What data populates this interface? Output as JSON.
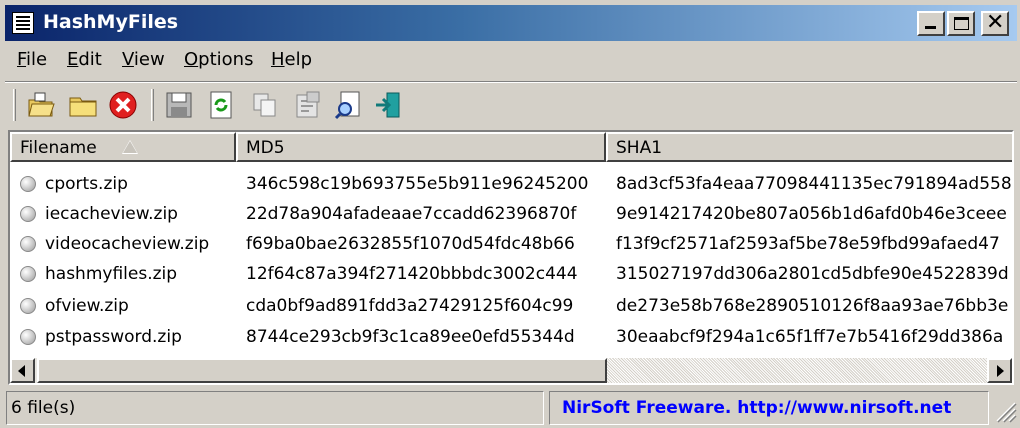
{
  "window": {
    "title": "HashMyFiles"
  },
  "menu": [
    "File",
    "Edit",
    "View",
    "Options",
    "Help"
  ],
  "toolbar": [
    {
      "name": "open-files-icon"
    },
    {
      "name": "open-folder-icon"
    },
    {
      "name": "remove-icon"
    },
    {
      "name": "save-icon"
    },
    {
      "name": "refresh-icon"
    },
    {
      "name": "copy-icon"
    },
    {
      "name": "properties-icon"
    },
    {
      "name": "find-icon"
    },
    {
      "name": "exit-icon"
    }
  ],
  "columns": [
    "Filename",
    "MD5",
    "SHA1"
  ],
  "rows": [
    {
      "filename": "cports.zip",
      "md5": "346c598c19b693755e5b911e96245200",
      "sha1": "8ad3cf53fa4eaa77098441135ec791894ad558"
    },
    {
      "filename": "iecacheview.zip",
      "md5": "22d78a904afadeaae7ccadd62396870f",
      "sha1": "9e914217420be807a056b1d6afd0b46e3ceee"
    },
    {
      "filename": "videocacheview.zip",
      "md5": "f69ba0bae2632855f1070d54fdc48b66",
      "sha1": "f13f9cf2571af2593af5be78e59fbd99afaed47"
    },
    {
      "filename": "hashmyfiles.zip",
      "md5": "12f64c87a394f271420bbbdc3002c444",
      "sha1": "315027197dd306a2801cd5dbfe90e4522839d"
    },
    {
      "filename": "ofview.zip",
      "md5": "cda0bf9ad891fdd3a27429125f604c99",
      "sha1": "de273e58b768e2890510126f8aa93ae76bb3e"
    },
    {
      "filename": "pstpassword.zip",
      "md5": "8744ce293cb9f3c1ca89ee0efd55344d",
      "sha1": "30eaabcf9f294a1c65f1ff7e7b5416f29dd386a"
    }
  ],
  "status": {
    "count": "6 file(s)",
    "credit": "NirSoft Freeware.  http://www.nirsoft.net"
  },
  "colors": {
    "title_start": "#0a246a",
    "title_end": "#a6caf0",
    "credit": "#0000ff",
    "chrome": "#d4d0c8"
  }
}
